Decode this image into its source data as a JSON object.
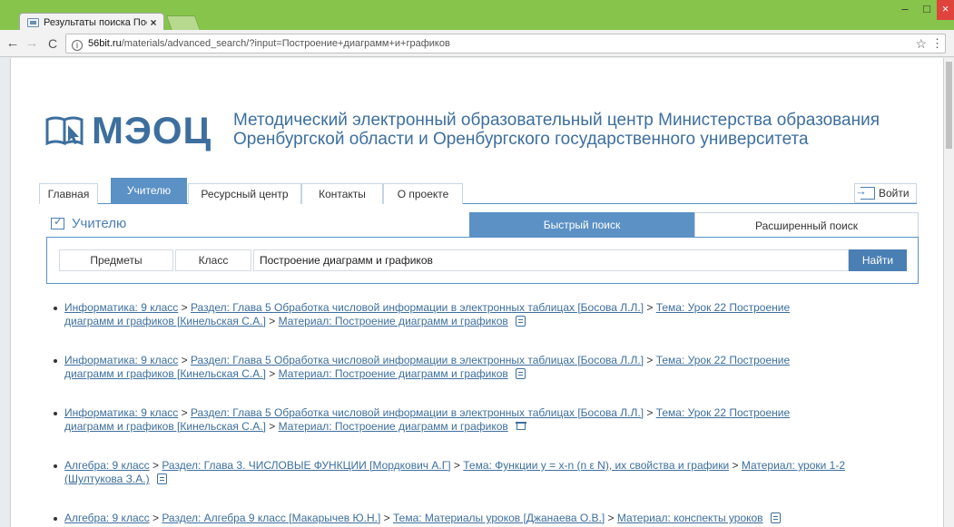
{
  "browser": {
    "tab_title": "Результаты поиска Пос",
    "tab_close": "×",
    "url_host": "56bit.ru",
    "url_path": "/materials/advanced_search/?input=Построение+диаграмм+и+графиков",
    "win_minimize": "–",
    "win_maximize": "□",
    "win_close": "×"
  },
  "site": {
    "logo_text": "МЭОЦ",
    "title_line1": "Методический электронный образовательный центр Министерства образования",
    "title_line2": "Оренбургской области и Оренбургского государственного университета"
  },
  "nav": {
    "items": [
      {
        "label": "Главная"
      },
      {
        "label": "Учителю",
        "active": true
      },
      {
        "label": "Ресурсный центр"
      },
      {
        "label": "Контакты"
      },
      {
        "label": "О проекте"
      }
    ],
    "login": "Войти"
  },
  "section": {
    "title": "Учителю"
  },
  "search": {
    "tab_fast": "Быстрый поиск",
    "tab_advanced": "Расширенный поиск",
    "filter_subjects": "Предметы",
    "filter_class": "Класс",
    "query": "Построение диаграмм и графиков",
    "find_button": "Найти"
  },
  "results": [
    {
      "subject": "Информатика: 9 класс",
      "section_line1": "Раздел: Глава 5 Обработка числовой информации в электронных таблицах [Босова Л.Л.]",
      "topic_a": "Тема: Урок 22 Построение",
      "topic_b": "диаграмм и графиков [Кинельская С.А.]",
      "material": "Материал: Построение диаграмм и графиков",
      "icon": "document-icon"
    },
    {
      "subject": "Информатика: 9 класс",
      "section_line1": "Раздел: Глава 5 Обработка числовой информации в электронных таблицах [Босова Л.Л.]",
      "topic_a": "Тема: Урок 22 Построение",
      "topic_b": "диаграмм и графиков [Кинельская С.А.]",
      "material": "Материал: Построение диаграмм и графиков",
      "icon": "document-icon"
    },
    {
      "subject": "Информатика: 9 класс",
      "section_line1": "Раздел: Глава 5 Обработка числовой информации в электронных таблицах [Босова Л.Л.]",
      "topic_a": "Тема: Урок 22 Построение",
      "topic_b": "диаграмм и графиков [Кинельская С.А.]",
      "material": "Материал: Построение диаграмм и графиков",
      "icon": "presentation-icon"
    },
    {
      "subject": "Алгебра: 9 класс",
      "section": "Раздел: Глава 3. ЧИСЛОВЫЕ ФУНКЦИИ [Мордкович А.Г]",
      "topic": "Тема: Функции y = x-n (n ε N), их свойства и графики",
      "material_a": "Материал: уроки 1-2",
      "material_b": "(Шултукова З.А.)",
      "icon": "document-icon"
    },
    {
      "subject": "Алгебра: 9 класс",
      "section": "Раздел: Алгебра 9 класс [Макарычев Ю.Н.]",
      "topic": "Тема: Материалы уроков [Джанаева О.В.]",
      "material": "Материал: конспекты уроков",
      "icon": "document-icon"
    }
  ],
  "separator": " > "
}
